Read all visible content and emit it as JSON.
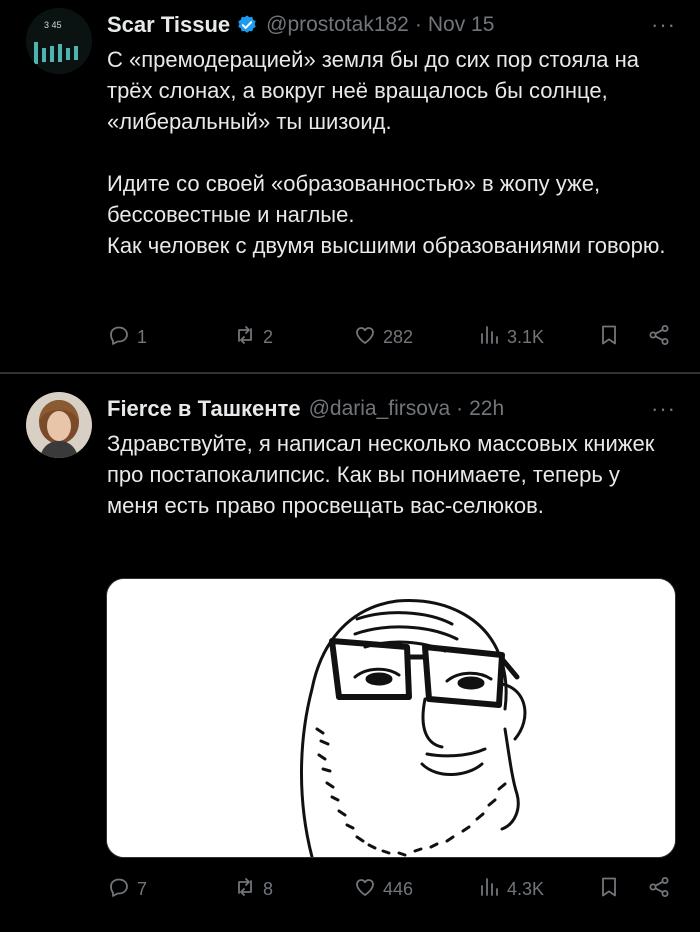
{
  "tweets": [
    {
      "avatar_text": "3 ₄₅",
      "name": "Scar Tissue",
      "verified": true,
      "handle": "@prostotak182",
      "separator": "·",
      "time": "Nov 15",
      "more": "···",
      "text_paragraphs": [
        "С «премодерацией» земля бы до сих пор стояла на трёх слонах, а вокруг неё вращалось бы солнце, «либеральный» ты шизоид.",
        "",
        "Идите со своей «образованностью» в жопу уже, бессовестные и наглые.",
        "Как человек с двумя высшими образованиями говорю."
      ],
      "actions": {
        "replies": "1",
        "retweets": "2",
        "likes": "282",
        "views": "3.1K"
      }
    },
    {
      "name": "Fierce в Ташкенте",
      "verified": false,
      "handle": "@daria_firsova",
      "separator": "·",
      "time": "22h",
      "more": "···",
      "text_paragraphs": [
        "Здравствуйте, я написал несколько массовых книжек про постапокалипсис. Как вы понимаете, теперь у меня есть право просвещать вас-селюков."
      ],
      "media": "soyjak-glasses-meme",
      "actions": {
        "replies": "7",
        "retweets": "8",
        "likes": "446",
        "views": "4.3K"
      }
    }
  ],
  "icons": [
    "reply-icon",
    "retweet-icon",
    "like-icon",
    "views-icon",
    "bookmark-icon",
    "share-icon",
    "verified-badge-icon"
  ],
  "colors": {
    "background": "#000000",
    "text": "#e7e9ea",
    "secondary": "#71767b",
    "verified": "#1d9bf0",
    "divider": "#2f3336"
  }
}
